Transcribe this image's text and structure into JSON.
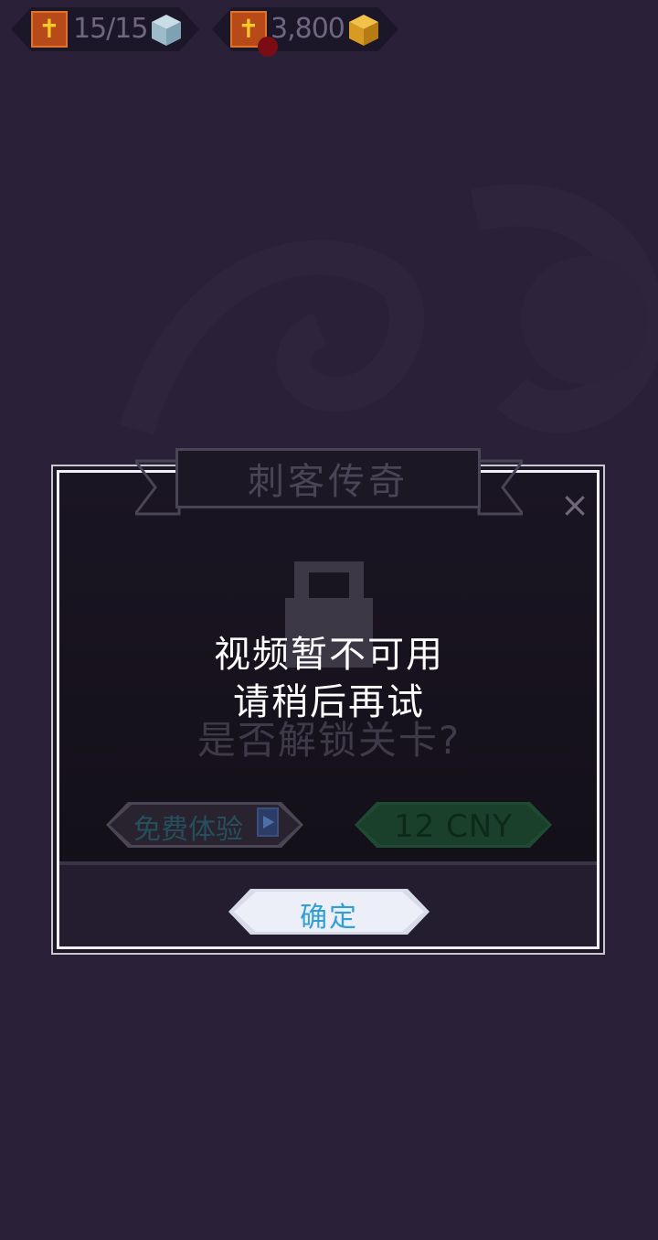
{
  "hud": {
    "lives_value": "15/15",
    "coins_value": "3,800",
    "badge_icon": "cross-icon",
    "lives_icon": "cube-icon",
    "coins_icon": "gold-cube-icon"
  },
  "dialog": {
    "title": "刺客传奇",
    "question": "是否解锁关卡?",
    "free_button_label": "免费体验",
    "buy_button_label": "12 CNY",
    "confirm_button_label": "确定",
    "close_icon": "close-icon",
    "lock_icon": "lock-icon"
  },
  "toast": {
    "line1": "视频暂不可用",
    "line2": "请稍后再试"
  },
  "colors": {
    "background": "#2a2139",
    "confirm_text": "#2f9fd6",
    "buy_button": "#1d4a31"
  }
}
